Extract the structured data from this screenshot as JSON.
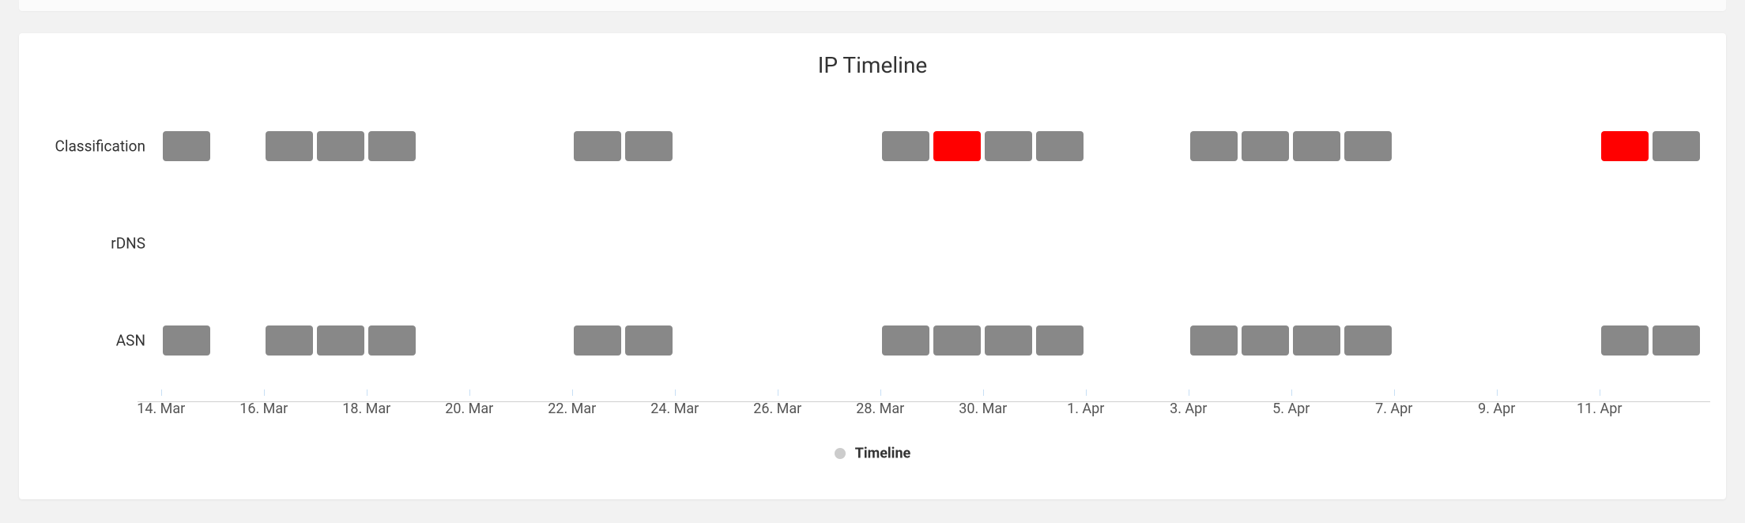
{
  "title": "IP Timeline",
  "legend_label": "Timeline",
  "colors": {
    "normal": "#888888",
    "alert": "#ff0000"
  },
  "y_categories": [
    "Classification",
    "rDNS",
    "ASN"
  ],
  "x_ticks": [
    "14. Mar",
    "16. Mar",
    "18. Mar",
    "20. Mar",
    "22. Mar",
    "24. Mar",
    "26. Mar",
    "28. Mar",
    "30. Mar",
    "1. Apr",
    "3. Apr",
    "5. Apr",
    "7. Apr",
    "9. Apr",
    "11. Apr"
  ],
  "chart_data": {
    "type": "bar",
    "title": "IP Timeline",
    "xlabel": "",
    "ylabel": "",
    "x_range_days": [
      "14. Mar",
      "12. Apr"
    ],
    "series": [
      {
        "name": "Classification",
        "events": [
          {
            "day": "14. Mar",
            "status": "normal"
          },
          {
            "day": "16. Mar",
            "status": "normal"
          },
          {
            "day": "17. Mar",
            "status": "normal"
          },
          {
            "day": "18. Mar",
            "status": "normal"
          },
          {
            "day": "22. Mar",
            "status": "normal"
          },
          {
            "day": "23. Mar",
            "status": "normal"
          },
          {
            "day": "28. Mar",
            "status": "normal"
          },
          {
            "day": "29. Mar",
            "status": "alert"
          },
          {
            "day": "30. Mar",
            "status": "normal"
          },
          {
            "day": "31. Mar",
            "status": "normal"
          },
          {
            "day": "3. Apr",
            "status": "normal"
          },
          {
            "day": "4. Apr",
            "status": "normal"
          },
          {
            "day": "5. Apr",
            "status": "normal"
          },
          {
            "day": "6. Apr",
            "status": "normal"
          },
          {
            "day": "11. Apr",
            "status": "alert"
          },
          {
            "day": "12. Apr",
            "status": "normal"
          }
        ]
      },
      {
        "name": "rDNS",
        "events": []
      },
      {
        "name": "ASN",
        "events": [
          {
            "day": "14. Mar",
            "status": "normal"
          },
          {
            "day": "16. Mar",
            "status": "normal"
          },
          {
            "day": "17. Mar",
            "status": "normal"
          },
          {
            "day": "18. Mar",
            "status": "normal"
          },
          {
            "day": "22. Mar",
            "status": "normal"
          },
          {
            "day": "23. Mar",
            "status": "normal"
          },
          {
            "day": "28. Mar",
            "status": "normal"
          },
          {
            "day": "29. Mar",
            "status": "normal"
          },
          {
            "day": "30. Mar",
            "status": "normal"
          },
          {
            "day": "31. Mar",
            "status": "normal"
          },
          {
            "day": "3. Apr",
            "status": "normal"
          },
          {
            "day": "4. Apr",
            "status": "normal"
          },
          {
            "day": "5. Apr",
            "status": "normal"
          },
          {
            "day": "6. Apr",
            "status": "normal"
          },
          {
            "day": "11. Apr",
            "status": "normal"
          },
          {
            "day": "12. Apr",
            "status": "normal"
          }
        ]
      }
    ]
  }
}
